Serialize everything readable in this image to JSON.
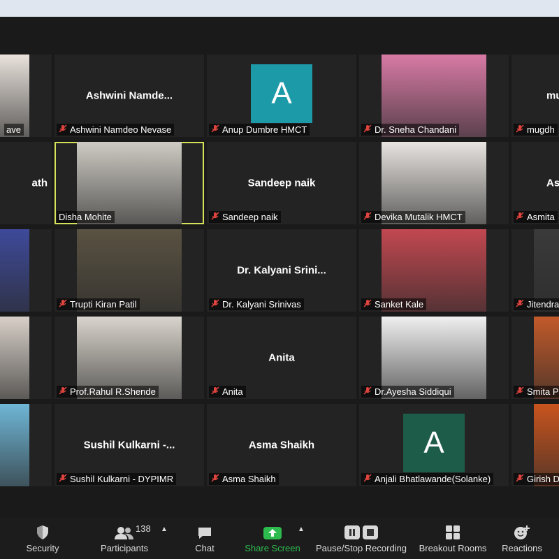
{
  "participants_grid": [
    {
      "id": "r1c1",
      "display_name": "",
      "label": "ave",
      "style": "photo",
      "bg": "#e9e2dc"
    },
    {
      "id": "r1c2",
      "display_name": "Ashwini  Namde...",
      "label": "Ashwini Namdeo Nevase",
      "style": "name"
    },
    {
      "id": "r1c3",
      "display_name": "A",
      "label": "Anup Dumbre HMCT",
      "style": "avatar",
      "avatar_color": "#1d9aa8"
    },
    {
      "id": "r1c4",
      "display_name": "",
      "label": "Dr. Sneha Chandani",
      "style": "photo",
      "bg": "#d87aa5"
    },
    {
      "id": "r1c5",
      "display_name": "mugd",
      "label": "mugdh",
      "style": "name"
    },
    {
      "id": "r2c1",
      "display_name": "ath",
      "label": "",
      "style": "name"
    },
    {
      "id": "r2c2",
      "display_name": "",
      "label": "Disha Mohite",
      "style": "photo",
      "bg": "#cfcbc4"
    },
    {
      "id": "r2c3",
      "display_name": "Sandeep naik",
      "label": "Sandeep naik",
      "style": "name"
    },
    {
      "id": "r2c4",
      "display_name": "",
      "label": "Devika Mutalik HMCT",
      "style": "photo",
      "bg": "#e8e4e0"
    },
    {
      "id": "r2c5",
      "display_name": "As",
      "label": "Asmita",
      "style": "name"
    },
    {
      "id": "r3c1",
      "display_name": "",
      "label": "",
      "style": "photo",
      "bg": "#3e4a9a"
    },
    {
      "id": "r3c2",
      "display_name": "",
      "label": "Trupti Kiran Patil",
      "style": "photo",
      "bg": "#5a5242"
    },
    {
      "id": "r3c3",
      "display_name": "Dr.  Kalyani  Srini...",
      "label": "Dr. Kalyani Srinivas",
      "style": "name"
    },
    {
      "id": "r3c4",
      "display_name": "",
      "label": "Sanket Kale",
      "style": "photo",
      "bg": "#c24850"
    },
    {
      "id": "r3c5",
      "display_name": "",
      "label": "Jitendra",
      "style": "photo",
      "bg": "#3a3a3a"
    },
    {
      "id": "r4c1",
      "display_name": "",
      "label": "",
      "style": "photo",
      "bg": "#d8d0c8"
    },
    {
      "id": "r4c2",
      "display_name": "",
      "label": "Prof.Rahul R.Shende",
      "style": "photo",
      "bg": "#d9d4cc"
    },
    {
      "id": "r4c3",
      "display_name": "Anita",
      "label": "Anita",
      "style": "name"
    },
    {
      "id": "r4c4",
      "display_name": "",
      "label": "Dr.Ayesha Siddiqui",
      "style": "photo",
      "bg": "#f0f0f0"
    },
    {
      "id": "r4c5",
      "display_name": "",
      "label": "Smita P",
      "style": "photo",
      "bg": "#c25a2a"
    },
    {
      "id": "r5c1",
      "display_name": "",
      "label": "",
      "style": "photo",
      "bg": "#6fb6d6"
    },
    {
      "id": "r5c2",
      "display_name": "Sushil  Kulkarni  -...",
      "label": "Sushil Kulkarni - DYPIMR",
      "style": "name"
    },
    {
      "id": "r5c3",
      "display_name": "Asma Shaikh",
      "label": "Asma Shaikh",
      "style": "name"
    },
    {
      "id": "r5c4",
      "display_name": "A",
      "label": "Anjali Bhatlawande(Solanke)",
      "style": "avatar",
      "avatar_color": "#1e5c4a"
    },
    {
      "id": "r5c5",
      "display_name": "",
      "label": "Girish D",
      "style": "photo",
      "bg": "#c9541e"
    }
  ],
  "toolbar": {
    "security": "Security",
    "participants": "Participants",
    "participants_count": "138",
    "chat": "Chat",
    "share_screen": "Share Screen",
    "recording": "Pause/Stop Recording",
    "breakout": "Breakout Rooms",
    "reactions": "Reactions"
  },
  "colors": {
    "share_green": "#2dbb4e",
    "active_border": "#d6e35a",
    "mute_red": "#e0443e"
  }
}
